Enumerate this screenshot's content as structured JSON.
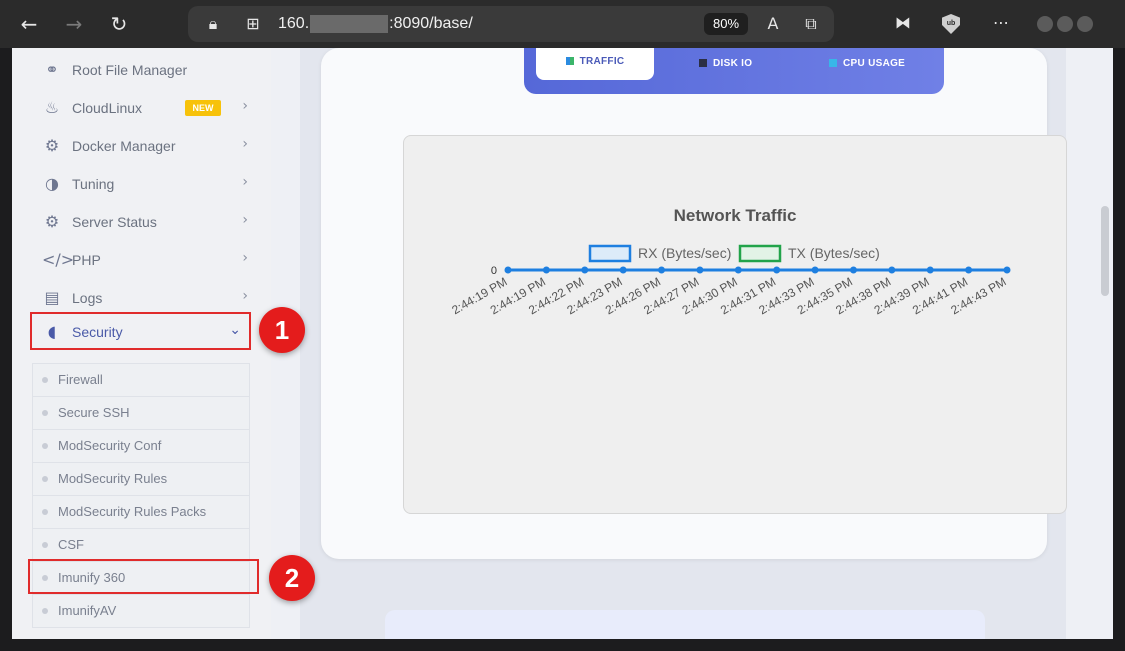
{
  "browser": {
    "url_prefix": "160.",
    "url_suffix": ":8090/base/",
    "zoom": "80%",
    "ublock_label": "ub"
  },
  "sidebar": {
    "items": [
      {
        "label": "Root File Manager",
        "icon": "link-icon",
        "glyph": "⚭",
        "chevron": false,
        "badge": ""
      },
      {
        "label": "CloudLinux",
        "icon": "flame-icon",
        "glyph": "♨",
        "chevron": true,
        "badge": "NEW"
      },
      {
        "label": "Docker Manager",
        "icon": "gears-icon",
        "glyph": "⚙",
        "chevron": true,
        "badge": ""
      },
      {
        "label": "Tuning",
        "icon": "contrast-icon",
        "glyph": "◑",
        "chevron": true,
        "badge": ""
      },
      {
        "label": "Server Status",
        "icon": "gear-icon",
        "glyph": "⚙",
        "chevron": true,
        "badge": ""
      },
      {
        "label": "PHP",
        "icon": "code-icon",
        "glyph": "</>",
        "chevron": true,
        "badge": ""
      },
      {
        "label": "Logs",
        "icon": "document-icon",
        "glyph": "▤",
        "chevron": true,
        "badge": ""
      }
    ],
    "security": {
      "label": "Security",
      "glyph": "◖"
    },
    "submenu": [
      "Firewall",
      "Secure SSH",
      "ModSecurity Conf",
      "ModSecurity Rules",
      "ModSecurity Rules Packs",
      "CSF",
      "Imunify 360",
      "ImunifyAV"
    ]
  },
  "markers": [
    "1",
    "2"
  ],
  "tabs": {
    "traffic": "TRAFFIC",
    "disk_io": "DISK IO",
    "cpu_usage": "CPU USAGE"
  },
  "chart_data": {
    "type": "line",
    "title": "Network Traffic",
    "x": [
      "2:44:19 PM",
      "2:44:19 PM",
      "2:44:22 PM",
      "2:44:23 PM",
      "2:44:26 PM",
      "2:44:27 PM",
      "2:44:30 PM",
      "2:44:31 PM",
      "2:44:33 PM",
      "2:44:35 PM",
      "2:44:38 PM",
      "2:44:39 PM",
      "2:44:41 PM",
      "2:44:43 PM"
    ],
    "series": [
      {
        "name": "RX (Bytes/sec)",
        "values": [
          0,
          0,
          0,
          0,
          0,
          0,
          0,
          0,
          0,
          0,
          0,
          0,
          0,
          0
        ],
        "color": "#1e7fe0"
      },
      {
        "name": "TX (Bytes/sec)",
        "values": [
          0,
          0,
          0,
          0,
          0,
          0,
          0,
          0,
          0,
          0,
          0,
          0,
          0,
          0
        ],
        "color": "#22a34a"
      }
    ],
    "y_ticks": [
      "0"
    ],
    "legend": "top"
  },
  "colors": {
    "accent": "#4a5aa8",
    "highlight": "#e02b2b",
    "badge": "#f7c20a"
  }
}
